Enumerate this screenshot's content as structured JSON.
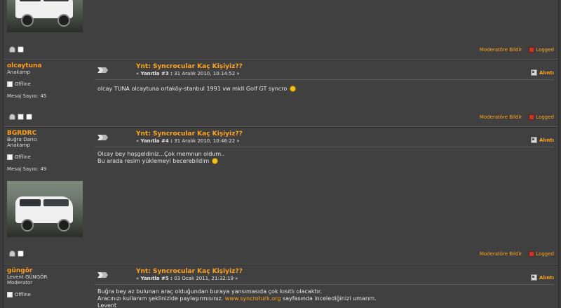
{
  "top_post": {
    "footer": {
      "report": "Moderatöre Bildir",
      "logged": "Logged"
    }
  },
  "posts": [
    {
      "name": "olcaytuna",
      "rank": "Anakamp",
      "status": "Offline",
      "message_count": "Mesaj Sayısı: 45",
      "title": "Ynt: Syncrocular Kaç Kişiyiz??",
      "reply_prefix": "«",
      "reply_label": "Yanıtla #3 :",
      "date": "31 Aralık 2010, 10:14:52 »",
      "quote": "Alıntı",
      "body": [
        "olcay TUNA   olcaytuna    ortaköy-stanbul     1991 vw mkII Golf GT syncro"
      ],
      "report": "Moderatöre Bildir",
      "logged": "Logged"
    },
    {
      "name": "BGRDRC",
      "real_name": "Buğra Darıcı",
      "rank": "Anakamp",
      "status": "Offline",
      "message_count": "Mesaj Sayısı: 49",
      "title": "Ynt: Syncrocular Kaç Kişiyiz??",
      "reply_prefix": "«",
      "reply_label": "Yanıtla #4 :",
      "date": "31 Aralık 2010, 10:46:22 »",
      "quote": "Alıntı",
      "body": [
        "Olcay bey hoşgeldiniz...Çok memnun oldum..",
        "Bu arada resim yüklemeyi becerebildim"
      ],
      "report": "Moderatöre Bildir",
      "logged": "Logged"
    },
    {
      "name": "güngör",
      "real_name": "Levent GÜNGÖR",
      "rank": "Moderator",
      "status": "Offline",
      "title": "Ynt: Syncrocular Kaç Kişiyiz??",
      "reply_prefix": "«",
      "reply_label": "Yanıtla #5 :",
      "date": "03 Ocak 2011, 21:32:19 »",
      "quote": "Alıntı",
      "body": [
        "Buğra bey az bulunan araç olduğundan buraya yansımasıda çok kısıtlı olacaktır.",
        "Aracınızı kullanım şeklinizide paylaşırmısınız.",
        "www.syncroturk.org",
        "sayfasında incelediğinizi umarım.",
        "Levent"
      ]
    }
  ],
  "icons": {
    "profile": "user-profile-icon",
    "mail": "mail-icon",
    "pm": "chat-icon",
    "post": "post-arrow-icon",
    "quote": "quote-icon",
    "warn": "report-flag-icon",
    "smiley": "smiley-icon"
  },
  "colors": {
    "accent": "#ffa41e",
    "background": "#404040",
    "text": "#e0e0e0"
  }
}
